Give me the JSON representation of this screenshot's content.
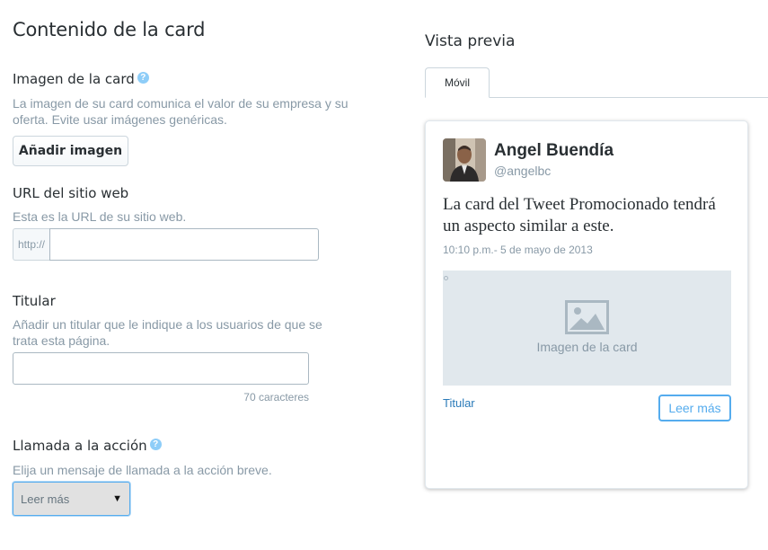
{
  "form": {
    "heading": "Contenido de la card",
    "image": {
      "label": "Imagen de la card",
      "help": "?",
      "description": "La imagen de su card comunica el valor de su empresa y su oferta. Evite usar imágenes genéricas.",
      "button": "Añadir imagen"
    },
    "url": {
      "label": "URL del sitio web",
      "description": "Esta es la URL de su sitio web.",
      "prefix": "http://",
      "value": ""
    },
    "headline": {
      "label": "Titular",
      "description": "Añadir un titular que le indique a los usuarios de que se trata esta página.",
      "value": "",
      "counter": "70 caracteres"
    },
    "cta": {
      "label": "Llamada a la acción",
      "help": "?",
      "description": "Elija un mensaje de llamada a la acción breve.",
      "selected": "Leer más",
      "arrow": "▼"
    }
  },
  "preview": {
    "heading": "Vista previa",
    "tabs": [
      {
        "label": "Móvil",
        "active": true
      }
    ],
    "card": {
      "name": "Angel Buendía",
      "handle": "@angelbc",
      "tweet": "La card del Tweet Promocionado tendrá un aspecto similar a este.",
      "timestamp": "10:10 p.m.- 5 de mayo de 2013",
      "image_placeholder": "Imagen de la card",
      "headline": "Titular",
      "cta_button": "Leer más"
    }
  },
  "colors": {
    "accent": "#55acee",
    "link": "#2b7bb9",
    "muted_text": "#8899a6",
    "placeholder_bg": "#e1e8ed"
  },
  "icons": {
    "help": "question-circle-icon",
    "image_placeholder": "image-icon",
    "select_arrow": "caret-down-icon"
  }
}
